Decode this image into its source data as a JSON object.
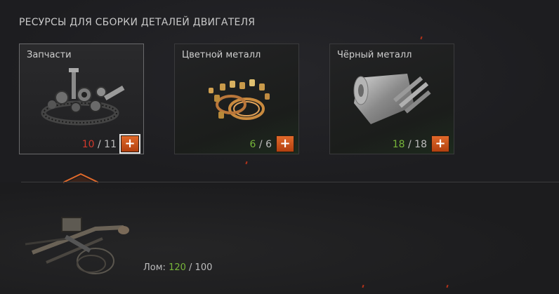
{
  "section_title": "РЕСУРСЫ ДЛЯ СБОРКИ ДЕТАЛЕЙ ДВИГАТЕЛЯ",
  "cards": [
    {
      "title": "Запчасти",
      "current": "10",
      "total": "11",
      "icon": "spare-parts-icon",
      "status_color": "#d2392c"
    },
    {
      "title": "Цветной металл",
      "current": "6",
      "total": "6",
      "icon": "nonferrous-metal-icon",
      "status_color": "#77b53a"
    },
    {
      "title": "Чёрный металл",
      "current": "18",
      "total": "18",
      "icon": "ferrous-metal-icon",
      "status_color": "#77b53a"
    }
  ],
  "separator": " / ",
  "plus_label": "+",
  "scrap": {
    "label": "Лом: ",
    "current": "120",
    "total": "100",
    "icon": "scrap-icon",
    "status_color": "#77b53a"
  },
  "accent_color": "#e0692a"
}
